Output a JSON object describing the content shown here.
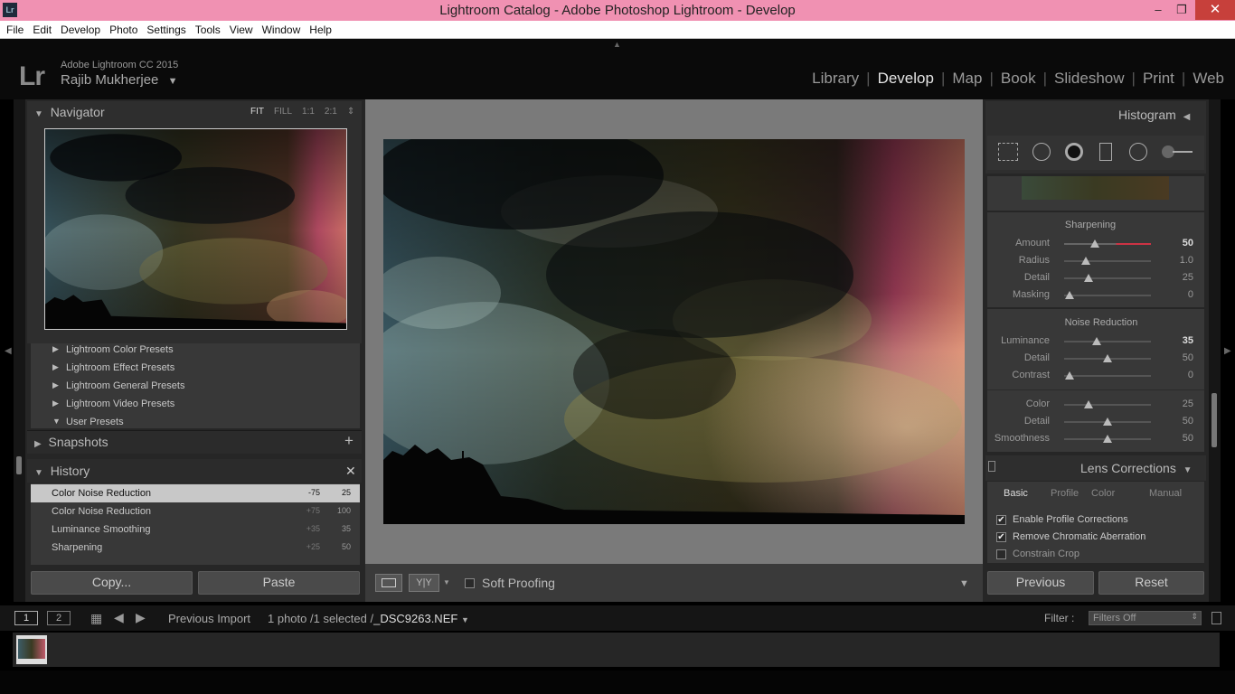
{
  "window": {
    "title": "Lightroom Catalog - Adobe Photoshop Lightroom - Develop",
    "app_icon": "Lr",
    "minimize": "–",
    "maximize": "❐",
    "close": "✕"
  },
  "menu": [
    "File",
    "Edit",
    "Develop",
    "Photo",
    "Settings",
    "Tools",
    "View",
    "Window",
    "Help"
  ],
  "identity": {
    "logo": "Lr",
    "version": "Adobe Lightroom CC 2015",
    "user": "Rajib Mukherjee"
  },
  "modules": [
    "Library",
    "Develop",
    "Map",
    "Book",
    "Slideshow",
    "Print",
    "Web"
  ],
  "active_module": "Develop",
  "navigator": {
    "title": "Navigator",
    "zoom_options": [
      "FIT",
      "FILL",
      "1:1",
      "2:1"
    ]
  },
  "presets": [
    "Lightroom Color Presets",
    "Lightroom Effect Presets",
    "Lightroom General Presets",
    "Lightroom Video Presets",
    "User Presets"
  ],
  "snapshots": {
    "title": "Snapshots",
    "add": "+"
  },
  "history": {
    "title": "History",
    "clear": "✕",
    "items": [
      {
        "label": "Color Noise Reduction",
        "delta": "-75",
        "value": "25",
        "selected": true
      },
      {
        "label": "Color Noise Reduction",
        "delta": "+75",
        "value": "100"
      },
      {
        "label": "Luminance Smoothing",
        "delta": "+35",
        "value": "35"
      },
      {
        "label": "Sharpening",
        "delta": "+25",
        "value": "50"
      }
    ]
  },
  "left_buttons": {
    "copy": "Copy...",
    "paste": "Paste"
  },
  "toolbar": {
    "soft_proofing": "Soft Proofing",
    "yy": "Y|Y"
  },
  "histogram": {
    "title": "Histogram"
  },
  "sharpening": {
    "title": "Sharpening",
    "sliders": [
      {
        "label": "Amount",
        "value": "50",
        "pos": 0.35,
        "hi": true,
        "red": true
      },
      {
        "label": "Radius",
        "value": "1.0",
        "pos": 0.25
      },
      {
        "label": "Detail",
        "value": "25",
        "pos": 0.28
      },
      {
        "label": "Masking",
        "value": "0",
        "pos": 0.06
      }
    ]
  },
  "noise_reduction": {
    "title": "Noise Reduction",
    "sliders": [
      {
        "label": "Luminance",
        "value": "35",
        "pos": 0.37,
        "hi": true
      },
      {
        "label": "Detail",
        "value": "50",
        "pos": 0.5
      },
      {
        "label": "Contrast",
        "value": "0",
        "pos": 0.06
      },
      {
        "label": "Color",
        "value": "25",
        "pos": 0.28
      },
      {
        "label": "Detail",
        "value": "50",
        "pos": 0.5
      },
      {
        "label": "Smoothness",
        "value": "50",
        "pos": 0.5
      }
    ]
  },
  "lens_corrections": {
    "title": "Lens Corrections",
    "tabs": [
      "Basic",
      "Profile",
      "Color",
      "Manual"
    ],
    "active_tab": "Basic",
    "checks": [
      {
        "label": "Enable Profile Corrections",
        "checked": true
      },
      {
        "label": "Remove Chromatic Aberration",
        "checked": true
      },
      {
        "label": "Constrain Crop",
        "checked": false
      }
    ]
  },
  "right_buttons": {
    "previous": "Previous",
    "reset": "Reset"
  },
  "filmstrip_bar": {
    "screen1": "1",
    "screen2": "2",
    "source": "Previous Import",
    "count": "1 photo /1 selected /",
    "filename": "_DSC9263.NEF",
    "filter_label": "Filter :",
    "filter_value": "Filters Off"
  }
}
